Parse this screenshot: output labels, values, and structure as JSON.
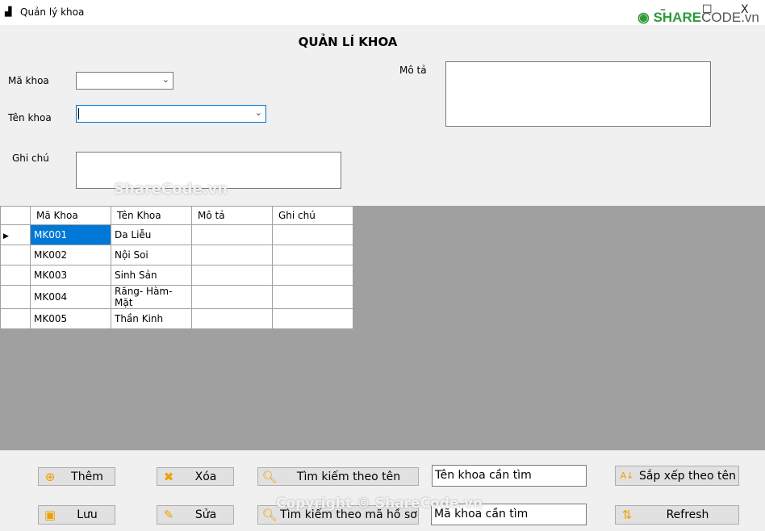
{
  "window": {
    "title": "Quản  lý khoa",
    "minimize": "–",
    "maximize": "☐",
    "close": "X",
    "logo_main": "SHARE",
    "logo_rest": "CODE.vn"
  },
  "form": {
    "heading": "QUẢN LÍ KHOA",
    "ma_khoa_label": "Mã khoa",
    "ten_khoa_label": "Tên khoa",
    "ghi_chu_label": "Ghi chú",
    "mo_ta_label": "Mô tả",
    "ma_khoa_value": "",
    "ten_khoa_value": "",
    "ghi_chu_value": "",
    "mo_ta_value": ""
  },
  "grid": {
    "columns": [
      "Mã Khoa",
      "Tên Khoa",
      "Mô tả",
      "Ghi chú"
    ],
    "rows": [
      [
        "MK001",
        "Da Liễu",
        "",
        ""
      ],
      [
        "MK002",
        "Nội Soi",
        "",
        ""
      ],
      [
        "MK003",
        "Sinh Sản",
        "",
        ""
      ],
      [
        "MK004",
        "Răng- Hàm- Mặt",
        "",
        ""
      ],
      [
        "MK005",
        "Thần Kinh",
        "",
        ""
      ]
    ],
    "selected_row": 0
  },
  "buttons": {
    "them": "Thêm",
    "xoa": "Xóa",
    "tim_ten": "Tìm kiếm theo tên",
    "sap_xep": "Sắp xếp theo tên",
    "luu": "Lưu",
    "sua": "Sửa",
    "tim_ma": "Tìm kiếm theo mã hồ sơ",
    "refresh": "Refresh"
  },
  "search": {
    "ten_value": "Tên khoa cần tìm",
    "ma_value": "Mã khoa cần tìm"
  },
  "watermarks": {
    "center": "ShareCode.vn",
    "bottom": "Copyright © ShareCode.vn"
  },
  "colors": {
    "selection": "#0078d7",
    "icon": "#f0a000",
    "grid_bg": "#a0a0a0"
  }
}
